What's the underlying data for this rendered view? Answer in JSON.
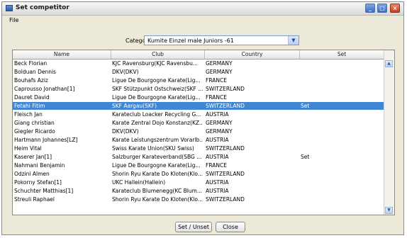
{
  "window": {
    "title": "Set competitor",
    "controls": [
      "minimize-icon",
      "maximize-icon",
      "close-icon"
    ]
  },
  "menu": {
    "file": "File"
  },
  "category": {
    "label": "Category",
    "value": "Kumite Einzel male Juniors -61"
  },
  "table": {
    "columns": [
      "Name",
      "Club",
      "Country",
      "Set"
    ],
    "rows": [
      {
        "name": "Beck Florian",
        "club": "KJC Ravensburg(KJC Ravensbu...",
        "country": "GERMANY",
        "set": ""
      },
      {
        "name": "Bolduan Dennis",
        "club": "DKV(DKV)",
        "country": "GERMANY",
        "set": ""
      },
      {
        "name": "Bouhafs Aziz",
        "club": "Ligue De Bourgogne Karate(Lig...",
        "country": "FRANCE",
        "set": ""
      },
      {
        "name": "Caprousso Jonathan[1]",
        "club": "SKF Stützpunkt Ostschweiz(SKF ...",
        "country": "SWITZERLAND",
        "set": ""
      },
      {
        "name": "Dauret David",
        "club": "Ligue De Bourgogne Karate(Lig...",
        "country": "FRANCE",
        "set": ""
      },
      {
        "name": "Fetahi Fitim",
        "club": "SKF Aargau(SKF)",
        "country": "SWITZERLAND",
        "set": "Set",
        "selected": true
      },
      {
        "name": "Fleisch Jan",
        "club": "Karateclub Loacker Recycling G...",
        "country": "AUSTRIA",
        "set": ""
      },
      {
        "name": "Giang christian",
        "club": "Karate Zentral Dojo Konstanz(KZ...",
        "country": "GERMANY",
        "set": ""
      },
      {
        "name": "Giegler Ricardo",
        "club": "DKV(DKV)",
        "country": "GERMANY",
        "set": ""
      },
      {
        "name": "Hartmann Johannes[LZ]",
        "club": "Karate Leistungszentrum Vorarlb...",
        "country": "AUSTRIA",
        "set": ""
      },
      {
        "name": "Heim Vital",
        "club": "Swiss Karate Union(SKU Swiss)",
        "country": "SWITZERLAND",
        "set": ""
      },
      {
        "name": "Kaserer Jan[1]",
        "club": "Salzburger Karateverband(SBG ...",
        "country": "AUSTRIA",
        "set": "Set"
      },
      {
        "name": "Nahmani Benjamin",
        "club": "Ligue De Bourgogne Karate(Lig...",
        "country": "FRANCE",
        "set": ""
      },
      {
        "name": "Odzini Almen",
        "club": "Shorin Ryu Karate Do Kloten(Klo...",
        "country": "SWITZERLAND",
        "set": ""
      },
      {
        "name": "Pokorny Stefan[1]",
        "club": "UKC Hallein(Hallein)",
        "country": "AUSTRIA",
        "set": ""
      },
      {
        "name": "Schuchter Matthias[1]",
        "club": "Karateclub Blumenegg(KC Blum...",
        "country": "AUSTRIA",
        "set": ""
      },
      {
        "name": "Streuli Raphael",
        "club": "Shorin Ryu Karate Do Kloten(Klo...",
        "country": "SWITZERLAND",
        "set": ""
      }
    ]
  },
  "buttons": {
    "set_unset": "Set / Unset",
    "close": "Close"
  },
  "colors": {
    "selected_row": "#3f86d4",
    "window_bg": "#ece9d8"
  }
}
